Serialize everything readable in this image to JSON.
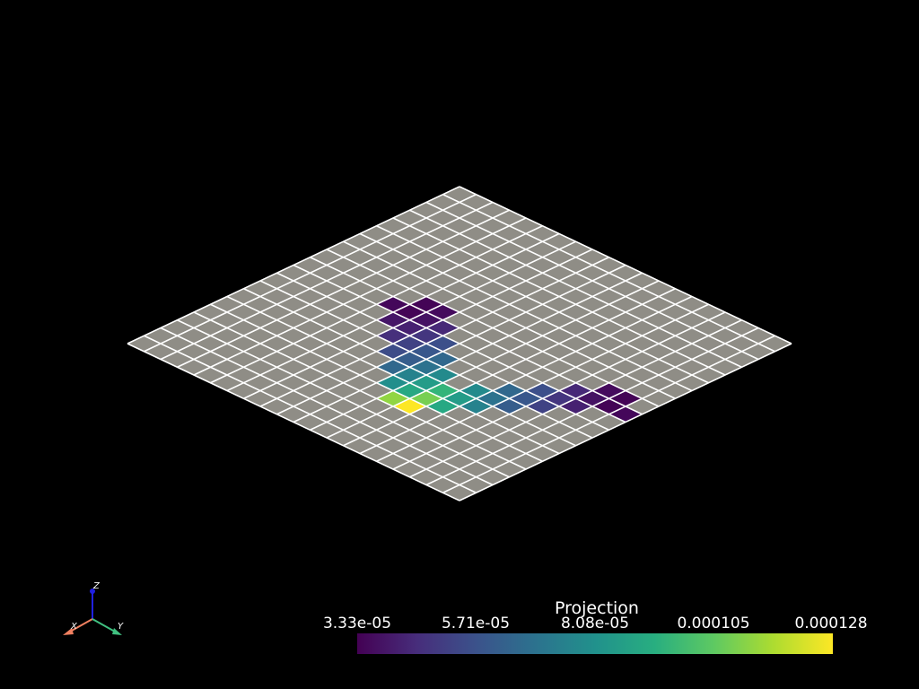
{
  "scene": {
    "background": "#000000",
    "grid": {
      "rows": 20,
      "cols": 20,
      "base_color": "#8f8d86",
      "line_color": "#ffffff"
    },
    "colored_cells": [
      {
        "r": 9,
        "c": 5,
        "v": 3.5e-05
      },
      {
        "r": 9,
        "c": 6,
        "v": 3.4e-05
      },
      {
        "r": 8,
        "c": 6,
        "v": 3.4e-05
      },
      {
        "r": 10,
        "c": 6,
        "v": 3.9e-05
      },
      {
        "r": 10,
        "c": 7,
        "v": 4.2e-05
      },
      {
        "r": 9,
        "c": 7,
        "v": 3.8e-05
      },
      {
        "r": 8,
        "c": 7,
        "v": 3.6e-05
      },
      {
        "r": 11,
        "c": 7,
        "v": 4.6e-05
      },
      {
        "r": 11,
        "c": 8,
        "v": 5.2e-05
      },
      {
        "r": 10,
        "c": 8,
        "v": 4.8e-05
      },
      {
        "r": 9,
        "c": 8,
        "v": 4.4e-05
      },
      {
        "r": 12,
        "c": 8,
        "v": 5.5e-05
      },
      {
        "r": 12,
        "c": 9,
        "v": 6.1e-05
      },
      {
        "r": 11,
        "c": 9,
        "v": 5.9e-05
      },
      {
        "r": 10,
        "c": 9,
        "v": 5.6e-05
      },
      {
        "r": 13,
        "c": 9,
        "v": 6.5e-05
      },
      {
        "r": 13,
        "c": 10,
        "v": 7.5e-05
      },
      {
        "r": 12,
        "c": 10,
        "v": 6.9e-05
      },
      {
        "r": 11,
        "c": 10,
        "v": 6.5e-05
      },
      {
        "r": 14,
        "c": 10,
        "v": 8e-05
      },
      {
        "r": 14,
        "c": 11,
        "v": 9e-05
      },
      {
        "r": 13,
        "c": 11,
        "v": 8.5e-05
      },
      {
        "r": 12,
        "c": 11,
        "v": 7.8e-05
      },
      {
        "r": 15,
        "c": 11,
        "v": 0.000112
      },
      {
        "r": 15,
        "c": 12,
        "v": 0.000128
      },
      {
        "r": 14,
        "c": 12,
        "v": 0.000108
      },
      {
        "r": 13,
        "c": 12,
        "v": 9.5e-05
      },
      {
        "r": 14,
        "c": 13,
        "v": 9e-05
      },
      {
        "r": 13,
        "c": 13,
        "v": 8.5e-05
      },
      {
        "r": 12,
        "c": 13,
        "v": 7.8e-05
      },
      {
        "r": 13,
        "c": 14,
        "v": 7.5e-05
      },
      {
        "r": 12,
        "c": 14,
        "v": 6.9e-05
      },
      {
        "r": 11,
        "c": 14,
        "v": 6.5e-05
      },
      {
        "r": 12,
        "c": 15,
        "v": 6.1e-05
      },
      {
        "r": 11,
        "c": 15,
        "v": 5.9e-05
      },
      {
        "r": 10,
        "c": 15,
        "v": 5.6e-05
      },
      {
        "r": 11,
        "c": 16,
        "v": 5.2e-05
      },
      {
        "r": 10,
        "c": 16,
        "v": 4.8e-05
      },
      {
        "r": 9,
        "c": 16,
        "v": 4.4e-05
      },
      {
        "r": 10,
        "c": 17,
        "v": 4.2e-05
      },
      {
        "r": 9,
        "c": 17,
        "v": 3.8e-05
      },
      {
        "r": 8,
        "c": 17,
        "v": 3.6e-05
      },
      {
        "r": 9,
        "c": 18,
        "v": 3.4e-05
      },
      {
        "r": 8,
        "c": 18,
        "v": 3.4e-05
      },
      {
        "r": 9,
        "c": 19,
        "v": 3.5e-05
      }
    ]
  },
  "colorbar": {
    "title": "Projection",
    "min": 3.33e-05,
    "max": 0.000128,
    "ticks": [
      "3.33e-05",
      "5.71e-05",
      "8.08e-05",
      "0.000105",
      "0.000128"
    ]
  },
  "axes": {
    "x_label": "X",
    "y_label": "Y",
    "z_label": "Z",
    "x_color": "#f08060",
    "y_color": "#40c080",
    "z_color": "#2020e0"
  }
}
